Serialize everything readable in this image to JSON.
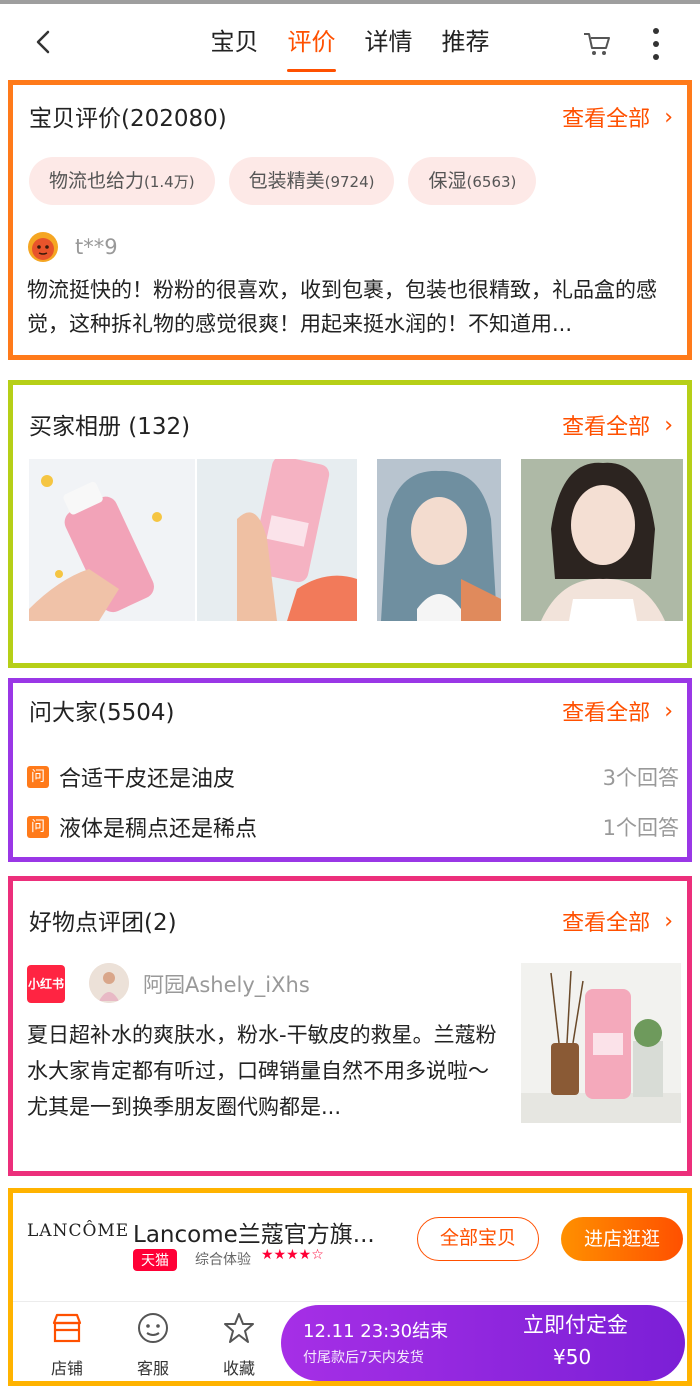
{
  "header": {
    "tabs": [
      {
        "label": "宝贝",
        "active": false
      },
      {
        "label": "评价",
        "active": true
      },
      {
        "label": "详情",
        "active": false
      },
      {
        "label": "推荐",
        "active": false
      }
    ],
    "icons": [
      "back-arrow-icon",
      "cart-icon",
      "more-vertical-icon"
    ]
  },
  "reviews": {
    "title": "宝贝评价(202080)",
    "see_all": "查看全部",
    "chips": [
      {
        "label": "物流也给力",
        "count": "(1.4万)"
      },
      {
        "label": "包装精美",
        "count": "(9724)"
      },
      {
        "label": "保湿",
        "count": "(6563)"
      }
    ],
    "user": "t**9",
    "text": "物流挺快的！粉粉的很喜欢，收到包裹，包装也很精致，礼品盒的感觉，这种拆礼物的感觉很爽！用起来挺水润的！不知道用..."
  },
  "album": {
    "title": "买家相册 (132)",
    "see_all": "查看全部"
  },
  "qa": {
    "title": "问大家(5504)",
    "see_all": "查看全部",
    "badge": "问",
    "items": [
      {
        "question": "合适干皮还是油皮",
        "answers": "3个回答"
      },
      {
        "question": "液体是稠点还是稀点",
        "answers": "1个回答"
      }
    ]
  },
  "goodstuff": {
    "title": "好物点评团(2)",
    "see_all": "查看全部",
    "source_logo": "小红书",
    "author": "阿园Ashely_iXhs",
    "text": "夏日超补水的爽肤水，粉水-干敏皮的救星。兰蔻粉水大家肯定都有听过，口碑销量自然不用多说啦～尤其是一到换季朋友圈代购都是..."
  },
  "store": {
    "logo": "LANCÔME",
    "name": "Lancome兰蔻官方旗...",
    "badge": "天猫",
    "experience": "综合体验",
    "stars": "★★★★☆",
    "all_items": "全部宝贝",
    "enter": "进店逛逛"
  },
  "bottom_nav": {
    "items": [
      {
        "label": "店铺",
        "icon": "store-icon"
      },
      {
        "label": "客服",
        "icon": "service-icon"
      },
      {
        "label": "收藏",
        "icon": "star-icon"
      }
    ],
    "deposit": {
      "time": "12.11 23:30结束",
      "note": "付尾款后7天内发货",
      "action": "立即付定金",
      "price": "¥50"
    }
  },
  "colors": {
    "accent": "#ff5000",
    "orange_frame": "#ff7a1a",
    "green_frame": "#b6cf17",
    "purple_frame": "#9a37e6",
    "pink_frame": "#ec2f7b",
    "yellow_frame": "#ffb300"
  }
}
